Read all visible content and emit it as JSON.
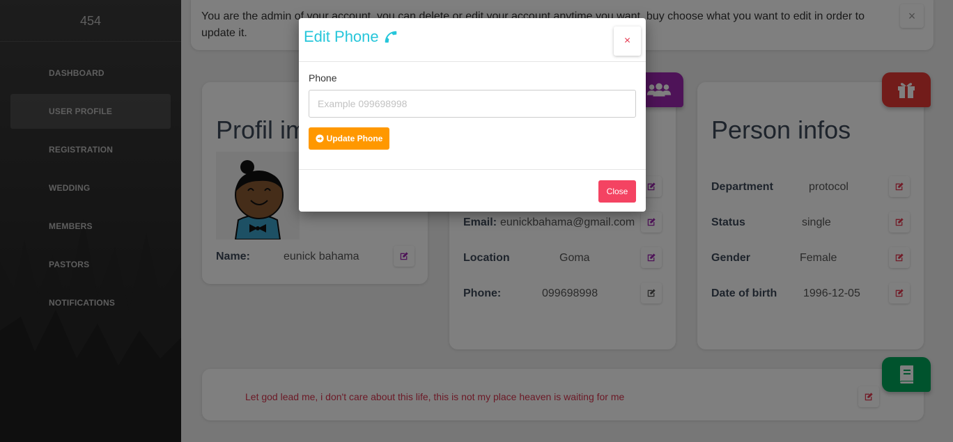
{
  "sidebar": {
    "brand": "454",
    "items": [
      {
        "label": "DASHBOARD"
      },
      {
        "label": "USER PROFILE"
      },
      {
        "label": "REGISTRATION"
      },
      {
        "label": "WEDDING"
      },
      {
        "label": "MEMBERS"
      },
      {
        "label": "PASTORS"
      },
      {
        "label": "NOTIFICATIONS"
      }
    ]
  },
  "alert": {
    "text": "You are the admin of your account, you can delete or edit your account anytime you want, buy choose what you want to edit in order to update it.",
    "close": "×"
  },
  "profile": {
    "title": "Profil image",
    "name_label": "Name:",
    "name_value": "eunick bahama"
  },
  "contact": {
    "email_label": "Email:",
    "email_value": "eunickbahama@gmail.com",
    "location_label": "Location",
    "location_value": "Goma",
    "phone_label": "Phone:",
    "phone_value": "099698998"
  },
  "person": {
    "title": "Person infos",
    "department_label": "Department",
    "department_value": "protocol",
    "status_label": "Status",
    "status_value": "single",
    "gender_label": "Gender",
    "gender_value": "Female",
    "dob_label": "Date of birth",
    "dob_value": "1996-12-05"
  },
  "quote": {
    "text": "Let god lead me, i don't care about this life, this is not my place heaven is waiting for me"
  },
  "modal": {
    "title": "Edit Phone",
    "close_x": "×",
    "field_label": "Phone",
    "placeholder": "Example 099698998",
    "update_label": "Update Phone",
    "close_label": "Close"
  },
  "colors": {
    "accent_cyan": "#26c6da",
    "update_orange": "#ff9800",
    "close_red": "#f44362",
    "edit_purple": "#9c27b0",
    "edit_red": "#e53950"
  }
}
